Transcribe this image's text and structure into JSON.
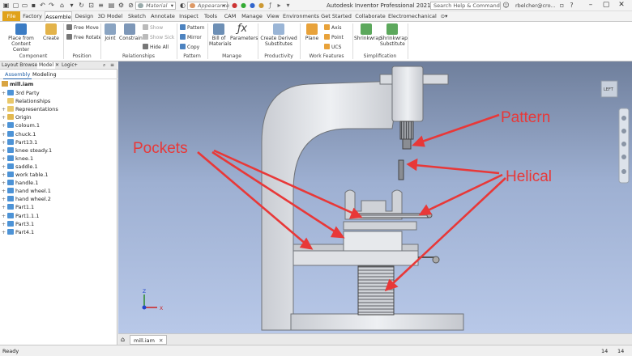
{
  "titlebar": {
    "material": "Material",
    "appearance": "Appearance",
    "title": "Autodesk Inventor Professional 2021    mill.iam",
    "search_placeholder": "Search Help & Commands...",
    "user": "rbelcher@cro..."
  },
  "ribbon_tabs": [
    "File",
    "Factory",
    "Assemble",
    "Design",
    "3D Model",
    "Sketch",
    "Annotate",
    "Inspect",
    "Tools",
    "CAM",
    "Manage",
    "View",
    "Environments",
    "Get Started",
    "Collaborate",
    "Electromechanical"
  ],
  "ribbon": {
    "place_label": "Place from Content Center",
    "create_label": "Create",
    "free_move": "Free Move",
    "free_rotate": "Free Rotate",
    "joint": "Joint",
    "constrain": "Constrain",
    "show": "Show",
    "show_sick": "Show Sick",
    "hide_all": "Hide All",
    "pattern": "Pattern",
    "mirror": "Mirror",
    "copy": "Copy",
    "bom": "Bill of Materials",
    "parameters": "Parameters",
    "create_derived": "Create Derived Substitutes",
    "plane": "Plane",
    "axis": "Axis",
    "point": "Point",
    "ucs": "UCS",
    "shrinkwrap": "Shrinkwrap",
    "shrinkwrap_sub": "Shrinkwrap Substitute",
    "groups": {
      "component": "Component",
      "position": "Position",
      "relationships": "Relationships",
      "pattern": "Pattern",
      "manage": "Manage",
      "productivity": "Productivity",
      "work_features": "Work Features",
      "simplification": "Simplification"
    }
  },
  "browser": {
    "tabs": [
      "Layout Browser",
      "Model",
      "Logic"
    ],
    "subtabs": [
      "Assembly",
      "Modeling"
    ],
    "root": "mill.iam",
    "items": [
      "3rd Party",
      "Relationships",
      "Representations",
      "Origin",
      "coloum.1",
      "chuck.1",
      "Part13.1",
      "knee steady.1",
      "knee.1",
      "saddle.1",
      "work table.1",
      "handle.1",
      "hand wheel.1",
      "hand wheel.2",
      "Part1.1",
      "Part1.1.1",
      "Part3.1",
      "Part4.1"
    ]
  },
  "viewport": {
    "callouts": {
      "pockets": "Pockets",
      "pattern": "Pattern",
      "helical": "Helical"
    },
    "viewcube": "LEFT",
    "axes": {
      "z": "Z",
      "x": "X"
    }
  },
  "doc_tab": "mill.iam",
  "status": {
    "text": "Ready",
    "num1": "14",
    "num2": "14"
  },
  "colors": {
    "arrow": "#e83838",
    "file_tab": "#e0a21a",
    "accent": "#1e5fa8"
  }
}
